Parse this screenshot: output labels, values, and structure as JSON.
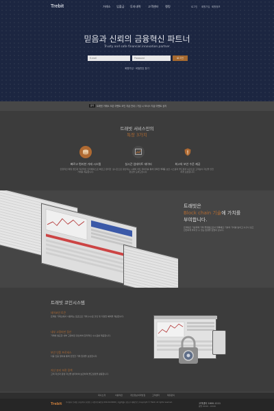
{
  "header": {
    "logo": "Trebit",
    "nav": [
      "거래소",
      "입출금",
      "투자내역",
      "고객센터",
      "랭킹"
    ],
    "utility": [
      "로그인",
      "회원가입",
      "회원정보"
    ]
  },
  "hero": {
    "title": "믿음과 신뢰의 금융혁신 파트너",
    "subtitle": "Trusty and safe financial innovation partner",
    "email_placeholder": "E-mail",
    "password_placeholder": "Password",
    "login_label": "로그인",
    "links": "회원가입 · 비밀번호 찾기"
  },
  "notice": {
    "badge": "공지",
    "text": "트래빗 거래소 오픈 이벤트 코인 지급 안내 / 가입 시 보너스 지급 이벤트 공지"
  },
  "features": {
    "title": "트래빗 서비스만의",
    "subtitle": "특장 3가지",
    "items": [
      {
        "icon": "coin-icon",
        "title": "빠르고 편리한 거래 시스템",
        "desc": "안정적인 매칭 엔진과 직관적인 인터페이스로 빠르고 편리한 거래를 제공합니다."
      },
      {
        "icon": "chart-icon",
        "title": "실시간 업데이트 데이터",
        "desc": "실시간으로 갱신되는 시세와 차트 데이터를 통해 정확한 투자 판단을 도와드립니다."
      },
      {
        "icon": "shield-icon",
        "title": "최고의 보안 수준 제공",
        "desc": "다중 보안 시스템과 콜드월렛 보관으로 고객님의 자산을 안전하게 보호합니다."
      }
    ]
  },
  "blockchain": {
    "line1": "트래빗은",
    "line2_accent": "Block chain 기술",
    "line2_rest": "에 가치를",
    "line3": "부여합니다.",
    "desc": "트래빗은 가상화폐 거래 플랫폼으로서 블록체인 기술의 가치를 높이고 누구나 쉽고 안전하게 투자할 수 있는 환경을 만들어 갑니다."
  },
  "coin_system": {
    "title": "트래빗 코인시스템",
    "items": [
      {
        "title": "데이코인 토큰",
        "desc": "트래빗 거래소에서 사용되는 토큰으로 거래 수수료 할인 및 다양한 혜택을 제공합니다."
      },
      {
        "title": "내부 고정비만 정산",
        "desc": "거래에 필요한 내부 고정비만 정산하여 합리적인 수수료를 제공합니다."
      },
      {
        "title": "보안 인증 프로세스",
        "desc": "다중 인증 절차를 통해 안전한 거래 환경을 보장합니다."
      },
      {
        "title": "자산 분리 보관 정책",
        "desc": "고객 자산과 운영 자산을 분리하여 보관하며 콜드월렛을 활용합니다."
      }
    ]
  },
  "footer": {
    "links": [
      "회사소개",
      "이용약관",
      "개인정보처리방침",
      "고객센터",
      "제휴문의"
    ],
    "logo": "Trebit",
    "info": "주식회사 트래빗 | 대표이사 홍길동 | 사업자등록번호 000-00-00000 | 서울특별시 강남구 테헤란로 | Copyright © Trebit. All rights reserved.",
    "tel_label": "고객센터 1600-1111",
    "tel_sub": "평일 09:00 - 18:00"
  },
  "colors": {
    "hero": "#1c2641",
    "accent": "#b06a32",
    "login_button": "#a6692f"
  }
}
